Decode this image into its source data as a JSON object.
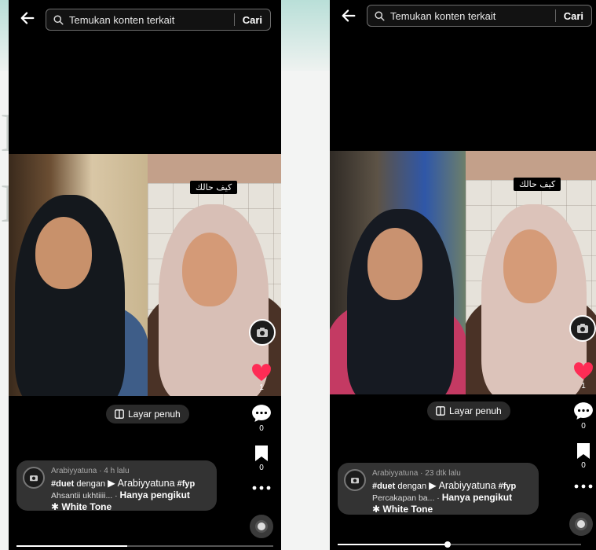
{
  "search": {
    "placeholder": "Temukan konten terkait",
    "action": "Cari"
  },
  "screens": [
    {
      "caption_overlay": "كيف حالك",
      "likes": "1",
      "comments": "0",
      "saves": "0",
      "fullscreen_label": "Layar penuh",
      "author_line": "Arabiyyatuna · 4 h lalu",
      "hashtag_line": {
        "tag": "#duet",
        "mid": " dengan ",
        "ref": "▶ Arabiyyatuna",
        "tag2": " #fyp"
      },
      "desc_line": {
        "text": "Ahsantii ukhtiiii... · ",
        "bold": "Hanya pengikut"
      },
      "effect_line": "✱ White Tone",
      "progress": 0.43
    },
    {
      "caption_overlay": "كيف حالك",
      "likes": "1",
      "comments": "0",
      "saves": "0",
      "fullscreen_label": "Layar penuh",
      "author_line": "Arabiyyatuna · 23 dtk lalu",
      "hashtag_line": {
        "tag": "#duet",
        "mid": " dengan ",
        "ref": "▶ Arabiyyatuna",
        "tag2": " #fyp"
      },
      "desc_line": {
        "text": "Percakapan ba... · ",
        "bold": "Hanya pengikut"
      },
      "effect_line": "✱ White Tone",
      "progress": 0.45
    }
  ],
  "colors": {
    "like": "#fe2c55",
    "surface": "#333333",
    "background": "#000000"
  },
  "icons": [
    "back-arrow-icon",
    "search-icon",
    "camera-icon",
    "heart-icon",
    "comment-icon",
    "bookmark-icon",
    "more-icon",
    "fullscreen-icon",
    "sound-disc-icon"
  ]
}
